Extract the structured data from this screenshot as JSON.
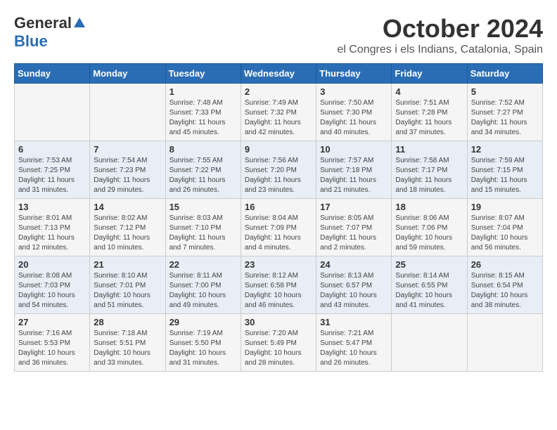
{
  "logo": {
    "general": "General",
    "blue": "Blue"
  },
  "title": "October 2024",
  "location": "el Congres i els Indians, Catalonia, Spain",
  "headers": [
    "Sunday",
    "Monday",
    "Tuesday",
    "Wednesday",
    "Thursday",
    "Friday",
    "Saturday"
  ],
  "weeks": [
    [
      {
        "day": "",
        "sunrise": "",
        "sunset": "",
        "daylight": ""
      },
      {
        "day": "",
        "sunrise": "",
        "sunset": "",
        "daylight": ""
      },
      {
        "day": "1",
        "sunrise": "Sunrise: 7:48 AM",
        "sunset": "Sunset: 7:33 PM",
        "daylight": "Daylight: 11 hours and 45 minutes."
      },
      {
        "day": "2",
        "sunrise": "Sunrise: 7:49 AM",
        "sunset": "Sunset: 7:32 PM",
        "daylight": "Daylight: 11 hours and 42 minutes."
      },
      {
        "day": "3",
        "sunrise": "Sunrise: 7:50 AM",
        "sunset": "Sunset: 7:30 PM",
        "daylight": "Daylight: 11 hours and 40 minutes."
      },
      {
        "day": "4",
        "sunrise": "Sunrise: 7:51 AM",
        "sunset": "Sunset: 7:28 PM",
        "daylight": "Daylight: 11 hours and 37 minutes."
      },
      {
        "day": "5",
        "sunrise": "Sunrise: 7:52 AM",
        "sunset": "Sunset: 7:27 PM",
        "daylight": "Daylight: 11 hours and 34 minutes."
      }
    ],
    [
      {
        "day": "6",
        "sunrise": "Sunrise: 7:53 AM",
        "sunset": "Sunset: 7:25 PM",
        "daylight": "Daylight: 11 hours and 31 minutes."
      },
      {
        "day": "7",
        "sunrise": "Sunrise: 7:54 AM",
        "sunset": "Sunset: 7:23 PM",
        "daylight": "Daylight: 11 hours and 29 minutes."
      },
      {
        "day": "8",
        "sunrise": "Sunrise: 7:55 AM",
        "sunset": "Sunset: 7:22 PM",
        "daylight": "Daylight: 11 hours and 26 minutes."
      },
      {
        "day": "9",
        "sunrise": "Sunrise: 7:56 AM",
        "sunset": "Sunset: 7:20 PM",
        "daylight": "Daylight: 11 hours and 23 minutes."
      },
      {
        "day": "10",
        "sunrise": "Sunrise: 7:57 AM",
        "sunset": "Sunset: 7:18 PM",
        "daylight": "Daylight: 11 hours and 21 minutes."
      },
      {
        "day": "11",
        "sunrise": "Sunrise: 7:58 AM",
        "sunset": "Sunset: 7:17 PM",
        "daylight": "Daylight: 11 hours and 18 minutes."
      },
      {
        "day": "12",
        "sunrise": "Sunrise: 7:59 AM",
        "sunset": "Sunset: 7:15 PM",
        "daylight": "Daylight: 11 hours and 15 minutes."
      }
    ],
    [
      {
        "day": "13",
        "sunrise": "Sunrise: 8:01 AM",
        "sunset": "Sunset: 7:13 PM",
        "daylight": "Daylight: 11 hours and 12 minutes."
      },
      {
        "day": "14",
        "sunrise": "Sunrise: 8:02 AM",
        "sunset": "Sunset: 7:12 PM",
        "daylight": "Daylight: 11 hours and 10 minutes."
      },
      {
        "day": "15",
        "sunrise": "Sunrise: 8:03 AM",
        "sunset": "Sunset: 7:10 PM",
        "daylight": "Daylight: 11 hours and 7 minutes."
      },
      {
        "day": "16",
        "sunrise": "Sunrise: 8:04 AM",
        "sunset": "Sunset: 7:09 PM",
        "daylight": "Daylight: 11 hours and 4 minutes."
      },
      {
        "day": "17",
        "sunrise": "Sunrise: 8:05 AM",
        "sunset": "Sunset: 7:07 PM",
        "daylight": "Daylight: 11 hours and 2 minutes."
      },
      {
        "day": "18",
        "sunrise": "Sunrise: 8:06 AM",
        "sunset": "Sunset: 7:06 PM",
        "daylight": "Daylight: 10 hours and 59 minutes."
      },
      {
        "day": "19",
        "sunrise": "Sunrise: 8:07 AM",
        "sunset": "Sunset: 7:04 PM",
        "daylight": "Daylight: 10 hours and 56 minutes."
      }
    ],
    [
      {
        "day": "20",
        "sunrise": "Sunrise: 8:08 AM",
        "sunset": "Sunset: 7:03 PM",
        "daylight": "Daylight: 10 hours and 54 minutes."
      },
      {
        "day": "21",
        "sunrise": "Sunrise: 8:10 AM",
        "sunset": "Sunset: 7:01 PM",
        "daylight": "Daylight: 10 hours and 51 minutes."
      },
      {
        "day": "22",
        "sunrise": "Sunrise: 8:11 AM",
        "sunset": "Sunset: 7:00 PM",
        "daylight": "Daylight: 10 hours and 49 minutes."
      },
      {
        "day": "23",
        "sunrise": "Sunrise: 8:12 AM",
        "sunset": "Sunset: 6:58 PM",
        "daylight": "Daylight: 10 hours and 46 minutes."
      },
      {
        "day": "24",
        "sunrise": "Sunrise: 8:13 AM",
        "sunset": "Sunset: 6:57 PM",
        "daylight": "Daylight: 10 hours and 43 minutes."
      },
      {
        "day": "25",
        "sunrise": "Sunrise: 8:14 AM",
        "sunset": "Sunset: 6:55 PM",
        "daylight": "Daylight: 10 hours and 41 minutes."
      },
      {
        "day": "26",
        "sunrise": "Sunrise: 8:15 AM",
        "sunset": "Sunset: 6:54 PM",
        "daylight": "Daylight: 10 hours and 38 minutes."
      }
    ],
    [
      {
        "day": "27",
        "sunrise": "Sunrise: 7:16 AM",
        "sunset": "Sunset: 5:53 PM",
        "daylight": "Daylight: 10 hours and 36 minutes."
      },
      {
        "day": "28",
        "sunrise": "Sunrise: 7:18 AM",
        "sunset": "Sunset: 5:51 PM",
        "daylight": "Daylight: 10 hours and 33 minutes."
      },
      {
        "day": "29",
        "sunrise": "Sunrise: 7:19 AM",
        "sunset": "Sunset: 5:50 PM",
        "daylight": "Daylight: 10 hours and 31 minutes."
      },
      {
        "day": "30",
        "sunrise": "Sunrise: 7:20 AM",
        "sunset": "Sunset: 5:49 PM",
        "daylight": "Daylight: 10 hours and 28 minutes."
      },
      {
        "day": "31",
        "sunrise": "Sunrise: 7:21 AM",
        "sunset": "Sunset: 5:47 PM",
        "daylight": "Daylight: 10 hours and 26 minutes."
      },
      {
        "day": "",
        "sunrise": "",
        "sunset": "",
        "daylight": ""
      },
      {
        "day": "",
        "sunrise": "",
        "sunset": "",
        "daylight": ""
      }
    ]
  ]
}
